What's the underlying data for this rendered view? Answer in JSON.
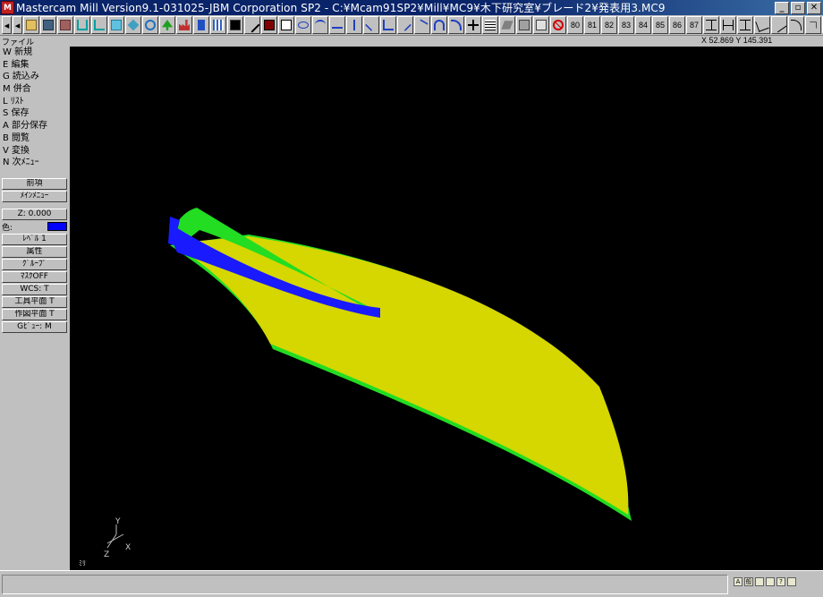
{
  "window": {
    "app_icon": "mastercam-icon",
    "title": "Mastercam Mill Version9.1-031025-JBM Corporation SP2 - C:¥Mcam91SP2¥Mill¥MC9¥木下研究室¥ブレード2¥発表用3.MC9",
    "minimize": "_",
    "maximize": "▫",
    "close": "✕"
  },
  "toolbar": {
    "numbers": [
      "80",
      "81",
      "82",
      "83",
      "84",
      "85",
      "86",
      "87"
    ]
  },
  "info": {
    "label": "ファイル",
    "coords": "X 52.869   Y 145.391"
  },
  "menu": {
    "items": [
      "W 新規",
      "E 編集",
      "G 読込み",
      "M 併合",
      "L ﾘｽﾄ",
      "S 保存",
      "A 部分保存",
      "B 閲覧",
      "V 変換",
      "N 次ﾒﾆｭｰ"
    ],
    "prev": "前項",
    "main_menu": "ﾒｲﾝﾒﾆｭｰ",
    "z": "Z:  0.000",
    "color_label": "色:",
    "level": "ﾚﾍﾞﾙ 1",
    "attributes": "属性",
    "group": "ｸﾞﾙｰﾌﾟ",
    "mask": "ﾏｽｸOFF",
    "wcs": "WCS:  T",
    "tool_plane": "工具平面   T",
    "construction_plane": "作図平面   T",
    "gview": "Gﾋﾞｭｰ:  M"
  },
  "viewport": {
    "axis_y": "Y",
    "axis_z": "Z",
    "axis_x": "X",
    "units": "ﾐﾘ",
    "colors": {
      "surface": "#d6d600",
      "edge": "#22dd22",
      "blue": "#1a1aff",
      "background": "#000000"
    }
  }
}
